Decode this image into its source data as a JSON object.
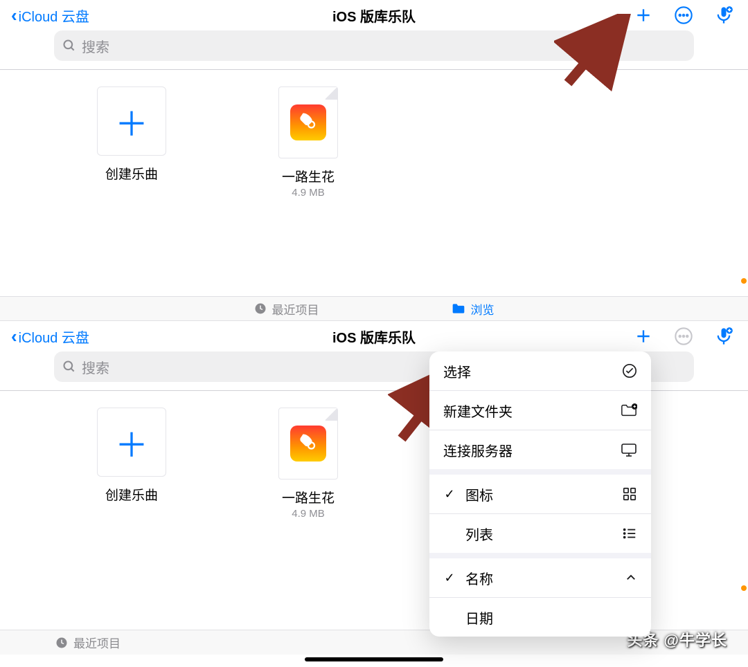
{
  "top": {
    "back_label": "iCloud 云盘",
    "title": "iOS 版库乐队",
    "search_placeholder": "搜索",
    "tiles": [
      {
        "label": "创建乐曲",
        "sub": ""
      },
      {
        "label": "一路生花",
        "sub": "4.9 MB"
      }
    ],
    "tabs": {
      "recent": "最近项目",
      "browse": "浏览"
    }
  },
  "bottom": {
    "back_label": "iCloud 云盘",
    "title": "iOS 版库乐队",
    "search_placeholder": "搜索",
    "tiles": [
      {
        "label": "创建乐曲",
        "sub": ""
      },
      {
        "label": "一路生花",
        "sub": "4.9 MB"
      }
    ],
    "menu": {
      "select": "选择",
      "new_folder": "新建文件夹",
      "connect_server": "连接服务器",
      "icon_view": "图标",
      "list_view": "列表",
      "sort_name": "名称",
      "sort_date": "日期"
    },
    "tabs": {
      "recent": "最近项目"
    }
  },
  "watermark": "头条 @牛学长"
}
